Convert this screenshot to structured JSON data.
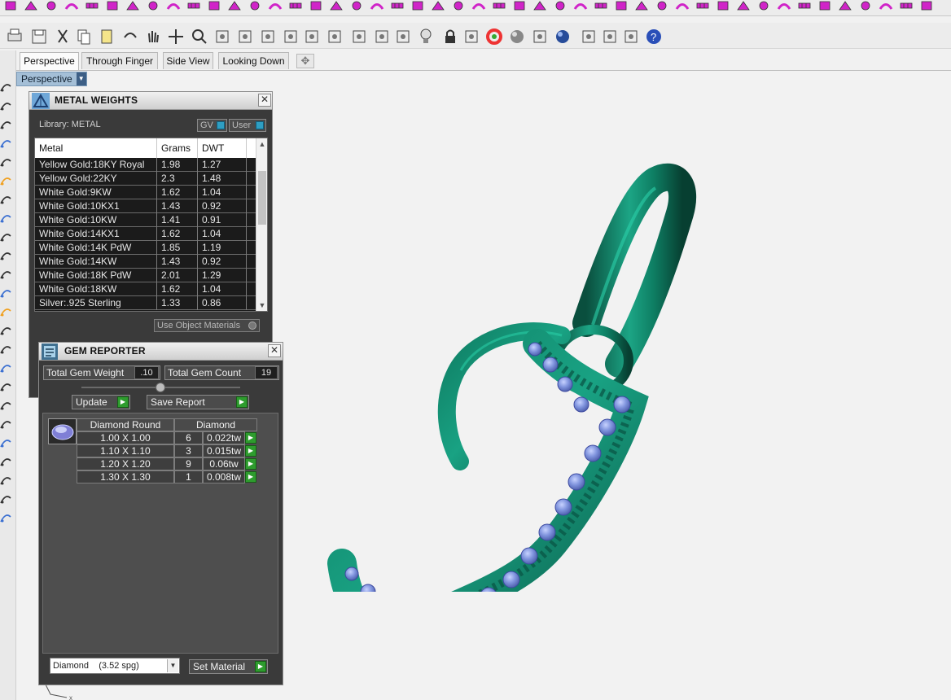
{
  "toolbar": {
    "std_icons": [
      "print-icon",
      "save-icon",
      "cut-icon",
      "copy-icon",
      "paste-icon",
      "undo-icon",
      "pan-hand-icon",
      "move-icon",
      "zoom-icon",
      "zoom-window-icon",
      "zoom-extents-icon",
      "zoom-selected-icon",
      "rotate-view-icon",
      "four-viewports-icon",
      "car-icon",
      "named-view-icon",
      "circle-icon",
      "points-icon",
      "light-icon",
      "lock-icon",
      "layer-icon",
      "color-wheel-icon",
      "sphere-icon",
      "render-sphere-icon",
      "blue-sphere-icon",
      "dimension-icon",
      "gear-icon",
      "options-icon",
      "help-icon"
    ]
  },
  "tabs": [
    {
      "label": "Perspective",
      "active": true
    },
    {
      "label": "Through Finger",
      "active": false
    },
    {
      "label": "Side View",
      "active": false
    },
    {
      "label": "Looking Down",
      "active": false
    }
  ],
  "viewport": {
    "label": "Perspective"
  },
  "metal_weights": {
    "title": "METAL WEIGHTS",
    "library_label": "Library: METAL",
    "gv_label": "GV",
    "user_label": "User",
    "columns": [
      "Metal",
      "Grams",
      "DWT"
    ],
    "rows": [
      {
        "metal": "Yellow Gold:18KY Royal",
        "grams": "1.98",
        "dwt": "1.27"
      },
      {
        "metal": "Yellow Gold:22KY",
        "grams": "2.3",
        "dwt": "1.48"
      },
      {
        "metal": "White Gold:9KW",
        "grams": "1.62",
        "dwt": "1.04"
      },
      {
        "metal": "White Gold:10KX1",
        "grams": "1.43",
        "dwt": "0.92"
      },
      {
        "metal": "White Gold:10KW",
        "grams": "1.41",
        "dwt": "0.91"
      },
      {
        "metal": "White Gold:14KX1",
        "grams": "1.62",
        "dwt": "1.04"
      },
      {
        "metal": "White Gold:14K PdW",
        "grams": "1.85",
        "dwt": "1.19"
      },
      {
        "metal": "White Gold:14KW",
        "grams": "1.43",
        "dwt": "0.92"
      },
      {
        "metal": "White Gold:18K PdW",
        "grams": "2.01",
        "dwt": "1.29"
      },
      {
        "metal": "White Gold:18KW",
        "grams": "1.62",
        "dwt": "1.04"
      },
      {
        "metal": "Silver:.925 Sterling",
        "grams": "1.33",
        "dwt": "0.86"
      }
    ],
    "use_object_materials_label": "Use Object Materials"
  },
  "gem_reporter": {
    "title": "GEM REPORTER",
    "total_weight_label": "Total Gem Weight",
    "total_weight_value": ".10",
    "total_count_label": "Total Gem Count",
    "total_count_value": "19",
    "update_label": "Update",
    "save_report_label": "Save Report",
    "col_shape": "Diamond Round",
    "col_material": "Diamond",
    "rows": [
      {
        "size": "1.00 X 1.00",
        "count": "6",
        "weight": "0.022tw"
      },
      {
        "size": "1.10 X 1.10",
        "count": "3",
        "weight": "0.015tw"
      },
      {
        "size": "1.20 X 1.20",
        "count": "9",
        "weight": "0.06tw"
      },
      {
        "size": "1.30 X 1.30",
        "count": "1",
        "weight": "0.008tw"
      }
    ],
    "material_select": "Diamond    (3.52 spg)",
    "set_material_label": "Set Material"
  },
  "colors": {
    "toolbar_magenta": "#d024c8",
    "pendant_green": "#0f7a62",
    "gem_blue": "#7f93dd",
    "viewport_label": "#a4bfd7"
  }
}
